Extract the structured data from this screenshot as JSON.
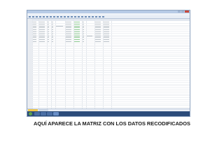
{
  "caption": "AQUÍ APARECE LA MATRIZ CON LOS DATOS RECODIFICADOS",
  "window": {
    "title": "",
    "menus": [
      "",
      "",
      "",
      "",
      "",
      "",
      "",
      "",
      ""
    ]
  },
  "grid": {
    "columns": [
      "",
      "",
      "",
      "",
      "",
      "",
      "",
      "",
      "",
      "",
      ""
    ],
    "row_count": 45,
    "rows_with_data": 11
  },
  "view_tabs": [
    "",
    ""
  ],
  "taskbar": {
    "clock_time": "",
    "clock_date": ""
  },
  "colors": {
    "active_tab": "#f2c94c",
    "taskbar": "#2b4b7a",
    "status_icon": "#4caf50",
    "window_border": "#8ea3bf"
  }
}
